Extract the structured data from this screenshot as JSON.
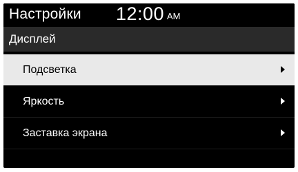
{
  "status_bar": {
    "title": "Настройки",
    "time": "12:00",
    "ampm": "AM"
  },
  "section": {
    "title": "Дисплей"
  },
  "menu": {
    "items": [
      {
        "label": "Подсветка",
        "selected": true,
        "icon": "chevron-right-icon"
      },
      {
        "label": "Яркость",
        "selected": false,
        "icon": "chevron-right-icon"
      },
      {
        "label": "Заставка экрана",
        "selected": false,
        "icon": "chevron-right-icon"
      }
    ]
  },
  "colors": {
    "background": "#000000",
    "header_bg": "#2a2a2a",
    "selected_bg": "#e9e9e9",
    "text": "#ffffff",
    "selected_text": "#000000"
  }
}
